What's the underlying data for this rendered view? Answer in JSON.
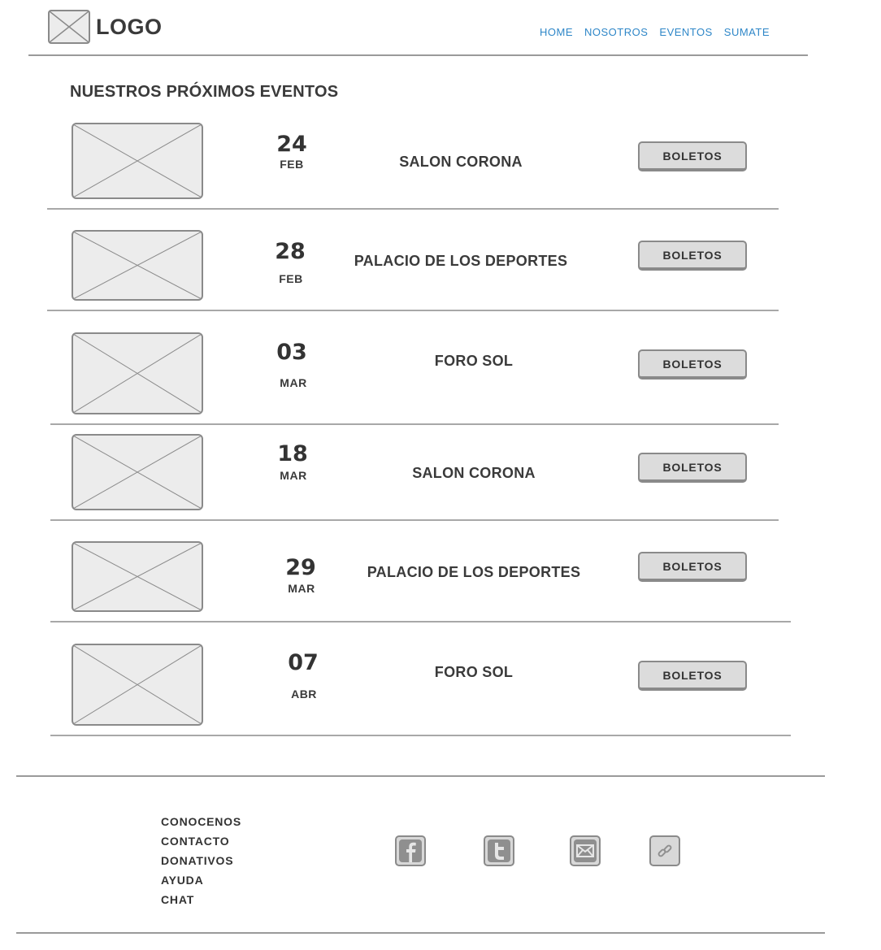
{
  "header": {
    "logo_text": "LOGO",
    "nav": [
      "HOME",
      "NOSOTROS",
      "EVENTOS",
      "SUMATE"
    ]
  },
  "section_title": "NUESTROS PRÓXIMOS EVENTOS",
  "events": [
    {
      "day": "24",
      "month": "FEB",
      "venue": "SALON CORONA",
      "button": "BOLETOS"
    },
    {
      "day": "28",
      "month": "FEB",
      "venue": "PALACIO DE LOS DEPORTES",
      "button": "BOLETOS"
    },
    {
      "day": "03",
      "month": "MAR",
      "venue": "FORO SOL",
      "button": "BOLETOS"
    },
    {
      "day": "18",
      "month": "MAR",
      "venue": "SALON CORONA",
      "button": "BOLETOS"
    },
    {
      "day": "29",
      "month": "MAR",
      "venue": "PALACIO DE LOS DEPORTES",
      "button": "BOLETOS"
    },
    {
      "day": "07",
      "month": "ABR",
      "venue": "FORO SOL",
      "button": "BOLETOS"
    }
  ],
  "footer": {
    "links": [
      "CONOCENOS",
      "CONTACTO",
      "DONATIVOS",
      "AYUDA",
      "CHAT"
    ],
    "social_icons": [
      "facebook-icon",
      "twitter-icon",
      "email-icon",
      "link-icon"
    ]
  },
  "colors": {
    "nav_link": "#2f87c8",
    "text": "#3a3a3a",
    "placeholder_fill": "#ececec",
    "button_fill": "#dcdcdc"
  }
}
